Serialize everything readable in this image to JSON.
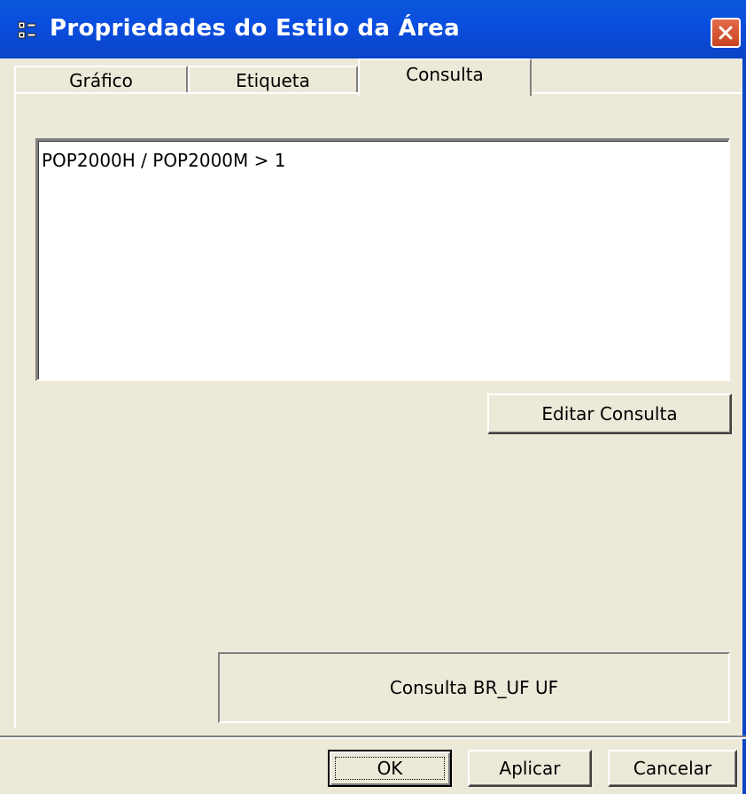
{
  "window": {
    "title": "Propriedades do Estilo da Área",
    "icon": "properties-window-icon",
    "close_icon": "close-icon",
    "accent_color": "#0a4ee0",
    "close_color": "#d9532f"
  },
  "tabs": [
    {
      "label": "Gráfico",
      "active": false
    },
    {
      "label": "Etiqueta",
      "active": false
    },
    {
      "label": "Consulta",
      "active": true
    }
  ],
  "query": {
    "expression": "POP2000H / POP2000M > 1"
  },
  "buttons": {
    "edit_query": "Editar Consulta",
    "ok": "OK",
    "apply": "Aplicar",
    "cancel": "Cancelar"
  },
  "info": {
    "text": "Consulta BR_UF UF"
  }
}
